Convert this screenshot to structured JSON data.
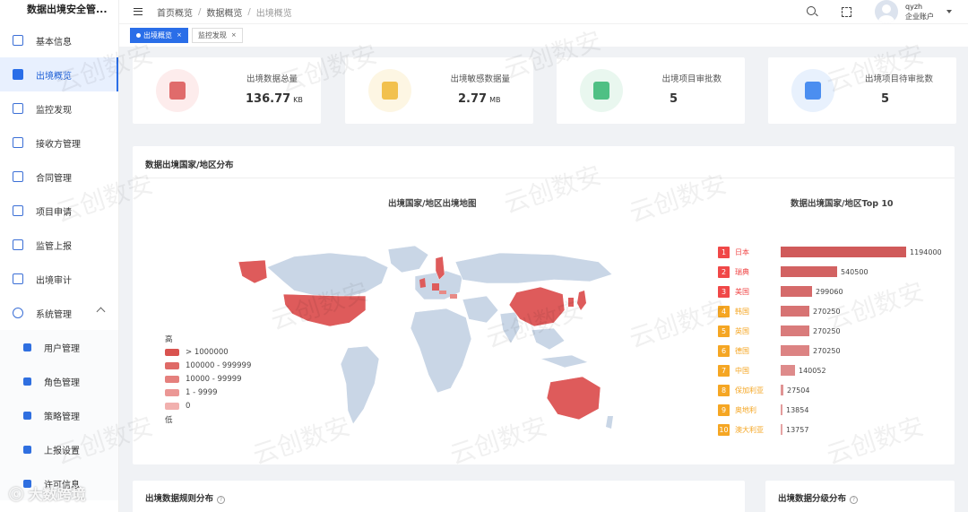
{
  "app": {
    "title": "数据出境安全管..."
  },
  "sidebar": {
    "items": [
      {
        "label": "基本信息",
        "icon": "info-icon",
        "color": "#3b6fd6"
      },
      {
        "label": "出境概览",
        "icon": "dashboard-icon",
        "color": "#2a6ee8",
        "active": true
      },
      {
        "label": "监控发现",
        "icon": "monitor-icon",
        "color": "#3b6fd6"
      },
      {
        "label": "接收方管理",
        "icon": "receiver-icon",
        "color": "#3b6fd6"
      },
      {
        "label": "合同管理",
        "icon": "contract-icon",
        "color": "#3b6fd6"
      },
      {
        "label": "项目申请",
        "icon": "project-icon",
        "color": "#3b6fd6"
      },
      {
        "label": "监管上报",
        "icon": "report-icon",
        "color": "#3b6fd6"
      },
      {
        "label": "出境审计",
        "icon": "audit-icon",
        "color": "#3b6fd6"
      },
      {
        "label": "系统管理",
        "icon": "gear-icon",
        "color": "#3b6fd6",
        "expanded": true
      }
    ],
    "subitems": [
      {
        "label": "用户管理",
        "icon": "user-icon"
      },
      {
        "label": "角色管理",
        "icon": "role-icon"
      },
      {
        "label": "策略管理",
        "icon": "policy-icon"
      },
      {
        "label": "上报设置",
        "icon": "report-settings-icon"
      },
      {
        "label": "许可信息",
        "icon": "license-icon"
      }
    ]
  },
  "header": {
    "breadcrumb": [
      "首页概览",
      "数据概览",
      "出境概览"
    ],
    "user": {
      "name": "qyzh",
      "role": "企业账户"
    }
  },
  "tags": [
    {
      "label": "出境概览",
      "active": true
    },
    {
      "label": "监控发现",
      "active": false
    }
  ],
  "stats": [
    {
      "label": "出境数据总量",
      "value": "136.77",
      "unit": "KB",
      "icon": "database-icon",
      "bg": "#fdecec",
      "fg": "#e06b6b"
    },
    {
      "label": "出境敏感数据量",
      "value": "2.77",
      "unit": "MB",
      "icon": "sensitive-data-icon",
      "bg": "#fdf6e3",
      "fg": "#f2c14e"
    },
    {
      "label": "出境项目审批数",
      "value": "5",
      "unit": "",
      "icon": "approval-icon",
      "bg": "#e9f7ef",
      "fg": "#4fc084"
    },
    {
      "label": "出境项目待审批数",
      "value": "5",
      "unit": "",
      "icon": "pending-icon",
      "bg": "#e8f1fd",
      "fg": "#4b8ef0"
    }
  ],
  "map_panel": {
    "title": "数据出境国家/地区分布",
    "map_title": "出境国家/地区出境地图",
    "top_title": "数据出境国家/地区Top 10",
    "legend": {
      "high": "高",
      "low": "低",
      "ranges": [
        {
          "label": "> 1000000",
          "color": "#d9534f"
        },
        {
          "label": "100000 - 999999",
          "color": "#df6a67"
        },
        {
          "label": "10000 - 99999",
          "color": "#e5807d"
        },
        {
          "label": "1 - 9999",
          "color": "#eb9795"
        },
        {
          "label": "0",
          "color": "#f1b0ae"
        }
      ]
    },
    "highlight_colors": {
      "land": "#c9d6e6",
      "hot": "#de5b5b",
      "mid": "#e88a86"
    }
  },
  "chart_data": {
    "type": "bar",
    "title": "数据出境国家/地区Top 10",
    "categories": [
      "日本",
      "瑞典",
      "美国",
      "韩国",
      "英国",
      "德国",
      "中国",
      "保加利亚",
      "奥地利",
      "澳大利亚"
    ],
    "values": [
      1194000,
      540500,
      299060,
      270250,
      270250,
      270250,
      140052,
      27504,
      13854,
      13757
    ],
    "rank_colors": [
      "#f04848",
      "#f04848",
      "#f04848",
      "#f5a623",
      "#f5a623",
      "#f5a623",
      "#f5a623",
      "#f5a623",
      "#f5a623",
      "#f5a623"
    ],
    "bar_color": "#d05a5a"
  },
  "bottom_panels": {
    "rules_title": "出境数据规则分布",
    "level_title": "出境数据分级分布"
  },
  "watermark": "云创数安",
  "footer_brand": "大数跨境"
}
